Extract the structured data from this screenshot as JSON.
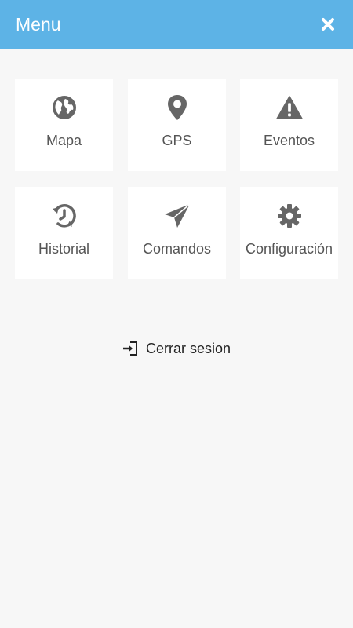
{
  "header": {
    "title": "Menu",
    "close_icon": "close-icon",
    "background_color": "#5db3e6"
  },
  "menu": {
    "items": [
      {
        "label": "Mapa",
        "icon": "globe-icon"
      },
      {
        "label": "GPS",
        "icon": "map-marker-icon"
      },
      {
        "label": "Eventos",
        "icon": "warning-icon"
      },
      {
        "label": "Historial",
        "icon": "history-icon"
      },
      {
        "label": "Comandos",
        "icon": "send-icon"
      },
      {
        "label": "Configuración",
        "icon": "gear-icon"
      }
    ]
  },
  "logout": {
    "label": "Cerrar sesion",
    "icon": "sign-in-icon"
  },
  "colors": {
    "accent": "#5db3e6",
    "icon": "#666666",
    "background": "#f7f7f7",
    "tile": "#ffffff"
  }
}
